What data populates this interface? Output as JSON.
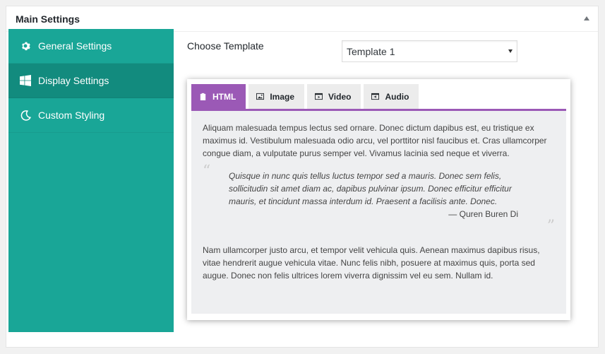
{
  "panel": {
    "title": "Main Settings"
  },
  "sidebar": {
    "items": [
      {
        "label": "General Settings",
        "icon": "gear-icon"
      },
      {
        "label": "Display Settings",
        "icon": "windows-icon",
        "active": true
      },
      {
        "label": "Custom Styling",
        "icon": "moon-icon"
      }
    ]
  },
  "content": {
    "choose_label": "Choose Template",
    "template_select": {
      "value": "Template 1"
    },
    "tabs": [
      {
        "label": "HTML",
        "icon": "clipboard-icon",
        "active": true
      },
      {
        "label": "Image",
        "icon": "image-icon"
      },
      {
        "label": "Video",
        "icon": "video-icon"
      },
      {
        "label": "Audio",
        "icon": "audio-icon"
      }
    ],
    "body": {
      "paragraph1": "Aliquam malesuada tempus lectus sed ornare. Donec dictum dapibus est, eu tristique ex maximus id. Vestibulum malesuada odio arcu, vel porttitor nisl faucibus et. Cras ullamcorper congue diam, a vulputate purus semper vel. Vivamus lacinia sed neque et viverra.",
      "quote": "Quisque in nunc quis tellus luctus tempor sed a mauris. Donec sem felis, sollicitudin sit amet diam ac, dapibus pulvinar ipsum. Donec efficitur efficitur mauris, et tincidunt massa interdum id. Praesent a facilisis ante. Donec.",
      "quote_author": "— Quren Buren Di",
      "paragraph2": "Nam ullamcorper justo arcu, et tempor velit vehicula quis. Aenean maximus dapibus risus, vitae hendrerit augue vehicula vitae. Nunc felis nibh, posuere at maximus quis, porta sed augue. Donec non felis ultrices lorem viverra dignissim vel eu sem. Nullam id."
    }
  },
  "colors": {
    "sidebar_bg": "#19a697",
    "sidebar_active": "#128b7e",
    "tab_accent": "#9b59b6",
    "tab_body_bg": "#eeeff1"
  }
}
